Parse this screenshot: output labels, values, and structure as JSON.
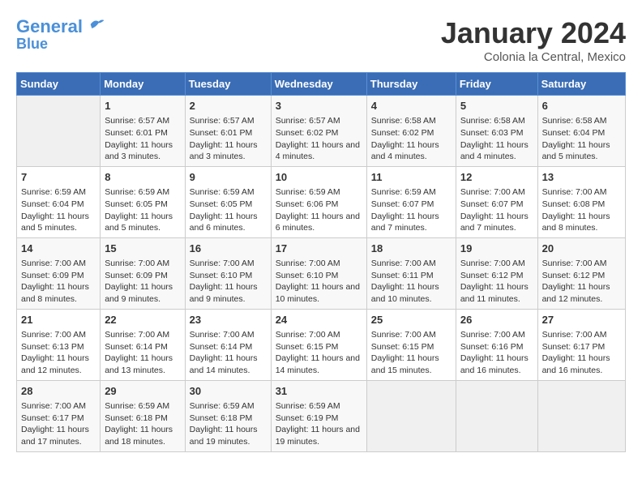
{
  "logo": {
    "line1": "General",
    "line2": "Blue"
  },
  "title": "January 2024",
  "subtitle": "Colonia la Central, Mexico",
  "weekdays": [
    "Sunday",
    "Monday",
    "Tuesday",
    "Wednesday",
    "Thursday",
    "Friday",
    "Saturday"
  ],
  "weeks": [
    [
      {
        "day": "",
        "empty": true
      },
      {
        "day": "1",
        "sunrise": "Sunrise: 6:57 AM",
        "sunset": "Sunset: 6:01 PM",
        "daylight": "Daylight: 11 hours and 3 minutes."
      },
      {
        "day": "2",
        "sunrise": "Sunrise: 6:57 AM",
        "sunset": "Sunset: 6:01 PM",
        "daylight": "Daylight: 11 hours and 3 minutes."
      },
      {
        "day": "3",
        "sunrise": "Sunrise: 6:57 AM",
        "sunset": "Sunset: 6:02 PM",
        "daylight": "Daylight: 11 hours and 4 minutes."
      },
      {
        "day": "4",
        "sunrise": "Sunrise: 6:58 AM",
        "sunset": "Sunset: 6:02 PM",
        "daylight": "Daylight: 11 hours and 4 minutes."
      },
      {
        "day": "5",
        "sunrise": "Sunrise: 6:58 AM",
        "sunset": "Sunset: 6:03 PM",
        "daylight": "Daylight: 11 hours and 4 minutes."
      },
      {
        "day": "6",
        "sunrise": "Sunrise: 6:58 AM",
        "sunset": "Sunset: 6:04 PM",
        "daylight": "Daylight: 11 hours and 5 minutes."
      }
    ],
    [
      {
        "day": "7",
        "sunrise": "Sunrise: 6:59 AM",
        "sunset": "Sunset: 6:04 PM",
        "daylight": "Daylight: 11 hours and 5 minutes."
      },
      {
        "day": "8",
        "sunrise": "Sunrise: 6:59 AM",
        "sunset": "Sunset: 6:05 PM",
        "daylight": "Daylight: 11 hours and 5 minutes."
      },
      {
        "day": "9",
        "sunrise": "Sunrise: 6:59 AM",
        "sunset": "Sunset: 6:05 PM",
        "daylight": "Daylight: 11 hours and 6 minutes."
      },
      {
        "day": "10",
        "sunrise": "Sunrise: 6:59 AM",
        "sunset": "Sunset: 6:06 PM",
        "daylight": "Daylight: 11 hours and 6 minutes."
      },
      {
        "day": "11",
        "sunrise": "Sunrise: 6:59 AM",
        "sunset": "Sunset: 6:07 PM",
        "daylight": "Daylight: 11 hours and 7 minutes."
      },
      {
        "day": "12",
        "sunrise": "Sunrise: 7:00 AM",
        "sunset": "Sunset: 6:07 PM",
        "daylight": "Daylight: 11 hours and 7 minutes."
      },
      {
        "day": "13",
        "sunrise": "Sunrise: 7:00 AM",
        "sunset": "Sunset: 6:08 PM",
        "daylight": "Daylight: 11 hours and 8 minutes."
      }
    ],
    [
      {
        "day": "14",
        "sunrise": "Sunrise: 7:00 AM",
        "sunset": "Sunset: 6:09 PM",
        "daylight": "Daylight: 11 hours and 8 minutes."
      },
      {
        "day": "15",
        "sunrise": "Sunrise: 7:00 AM",
        "sunset": "Sunset: 6:09 PM",
        "daylight": "Daylight: 11 hours and 9 minutes."
      },
      {
        "day": "16",
        "sunrise": "Sunrise: 7:00 AM",
        "sunset": "Sunset: 6:10 PM",
        "daylight": "Daylight: 11 hours and 9 minutes."
      },
      {
        "day": "17",
        "sunrise": "Sunrise: 7:00 AM",
        "sunset": "Sunset: 6:10 PM",
        "daylight": "Daylight: 11 hours and 10 minutes."
      },
      {
        "day": "18",
        "sunrise": "Sunrise: 7:00 AM",
        "sunset": "Sunset: 6:11 PM",
        "daylight": "Daylight: 11 hours and 10 minutes."
      },
      {
        "day": "19",
        "sunrise": "Sunrise: 7:00 AM",
        "sunset": "Sunset: 6:12 PM",
        "daylight": "Daylight: 11 hours and 11 minutes."
      },
      {
        "day": "20",
        "sunrise": "Sunrise: 7:00 AM",
        "sunset": "Sunset: 6:12 PM",
        "daylight": "Daylight: 11 hours and 12 minutes."
      }
    ],
    [
      {
        "day": "21",
        "sunrise": "Sunrise: 7:00 AM",
        "sunset": "Sunset: 6:13 PM",
        "daylight": "Daylight: 11 hours and 12 minutes."
      },
      {
        "day": "22",
        "sunrise": "Sunrise: 7:00 AM",
        "sunset": "Sunset: 6:14 PM",
        "daylight": "Daylight: 11 hours and 13 minutes."
      },
      {
        "day": "23",
        "sunrise": "Sunrise: 7:00 AM",
        "sunset": "Sunset: 6:14 PM",
        "daylight": "Daylight: 11 hours and 14 minutes."
      },
      {
        "day": "24",
        "sunrise": "Sunrise: 7:00 AM",
        "sunset": "Sunset: 6:15 PM",
        "daylight": "Daylight: 11 hours and 14 minutes."
      },
      {
        "day": "25",
        "sunrise": "Sunrise: 7:00 AM",
        "sunset": "Sunset: 6:15 PM",
        "daylight": "Daylight: 11 hours and 15 minutes."
      },
      {
        "day": "26",
        "sunrise": "Sunrise: 7:00 AM",
        "sunset": "Sunset: 6:16 PM",
        "daylight": "Daylight: 11 hours and 16 minutes."
      },
      {
        "day": "27",
        "sunrise": "Sunrise: 7:00 AM",
        "sunset": "Sunset: 6:17 PM",
        "daylight": "Daylight: 11 hours and 16 minutes."
      }
    ],
    [
      {
        "day": "28",
        "sunrise": "Sunrise: 7:00 AM",
        "sunset": "Sunset: 6:17 PM",
        "daylight": "Daylight: 11 hours and 17 minutes."
      },
      {
        "day": "29",
        "sunrise": "Sunrise: 6:59 AM",
        "sunset": "Sunset: 6:18 PM",
        "daylight": "Daylight: 11 hours and 18 minutes."
      },
      {
        "day": "30",
        "sunrise": "Sunrise: 6:59 AM",
        "sunset": "Sunset: 6:18 PM",
        "daylight": "Daylight: 11 hours and 19 minutes."
      },
      {
        "day": "31",
        "sunrise": "Sunrise: 6:59 AM",
        "sunset": "Sunset: 6:19 PM",
        "daylight": "Daylight: 11 hours and 19 minutes."
      },
      {
        "day": "",
        "empty": true
      },
      {
        "day": "",
        "empty": true
      },
      {
        "day": "",
        "empty": true
      }
    ]
  ]
}
